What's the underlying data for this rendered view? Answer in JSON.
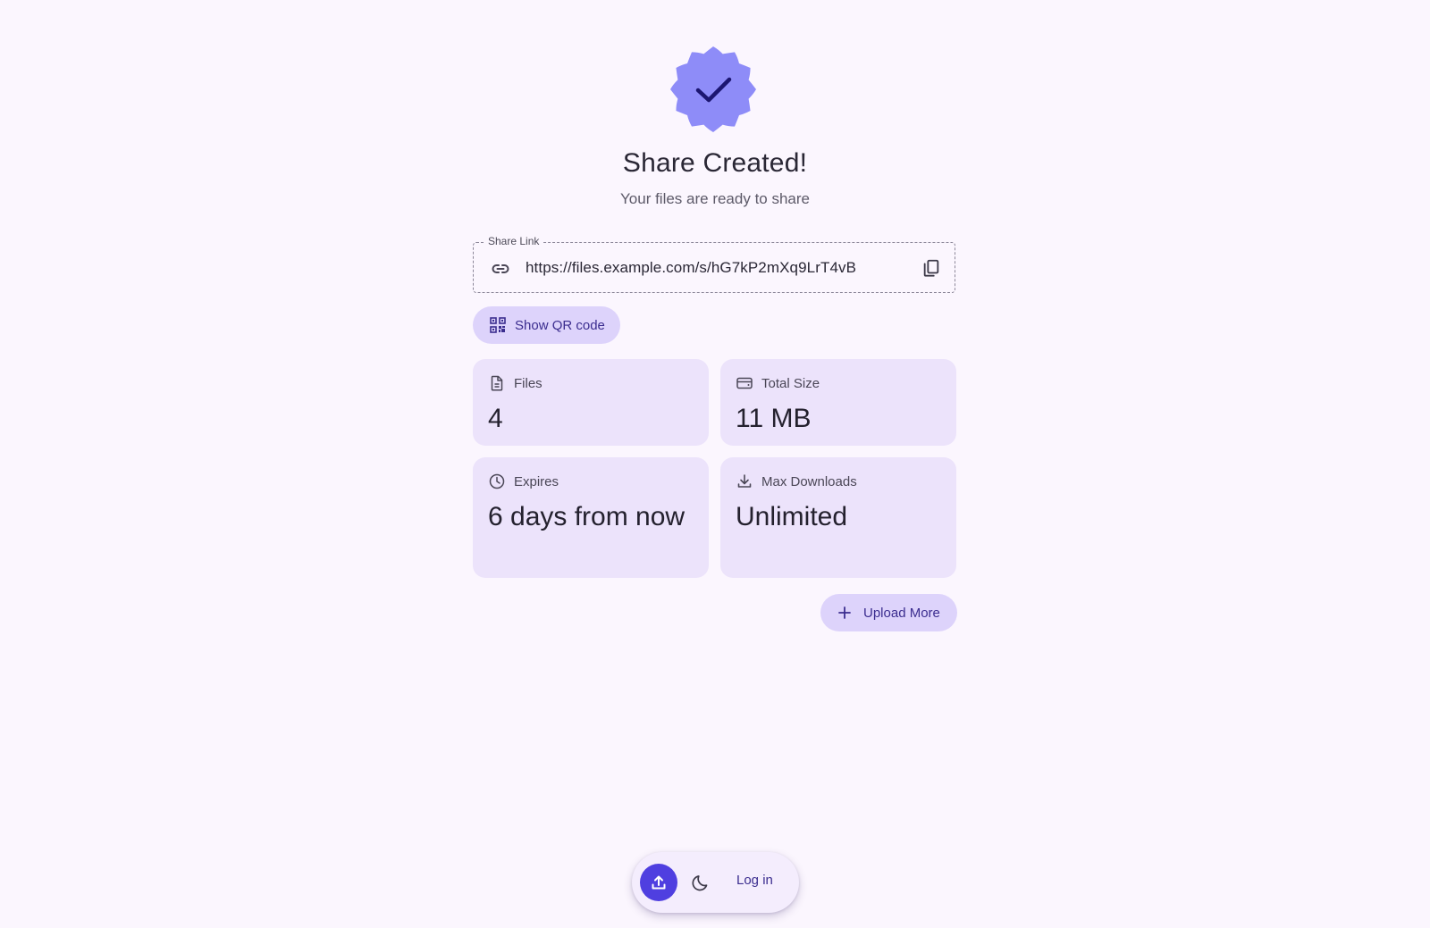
{
  "header": {
    "title": "Share Created!",
    "subtitle": "Your files are ready to share",
    "badge_icon": "check-badge-icon"
  },
  "share_link": {
    "legend": "Share Link",
    "url": "https://files.example.com/s/hG7kP2mXq9LrT4vB",
    "link_icon": "link-icon",
    "copy_icon": "copy-icon"
  },
  "qr_button": {
    "label": "Show QR code",
    "icon": "qr-code-icon"
  },
  "stats": {
    "files": {
      "label": "Files",
      "value": "4",
      "icon": "file-icon"
    },
    "total_size": {
      "label": "Total Size",
      "value": "11 MB",
      "icon": "storage-icon"
    },
    "expires": {
      "label": "Expires",
      "value": "6 days from now",
      "icon": "clock-icon"
    },
    "max_downloads": {
      "label": "Max Downloads",
      "value": "Unlimited",
      "icon": "download-icon"
    }
  },
  "upload_more_button": {
    "label": "Upload More",
    "icon": "plus-icon"
  },
  "bottom_bar": {
    "upload_icon": "upload-icon",
    "theme_icon": "moon-icon",
    "login_label": "Log in"
  },
  "colors": {
    "background": "#fbf6fe",
    "card": "#ece3fb",
    "pill_button": "#ddd3fb",
    "accent": "#4f3fe0",
    "badge": "#8e8cf8",
    "text_primary": "#2a2735"
  }
}
